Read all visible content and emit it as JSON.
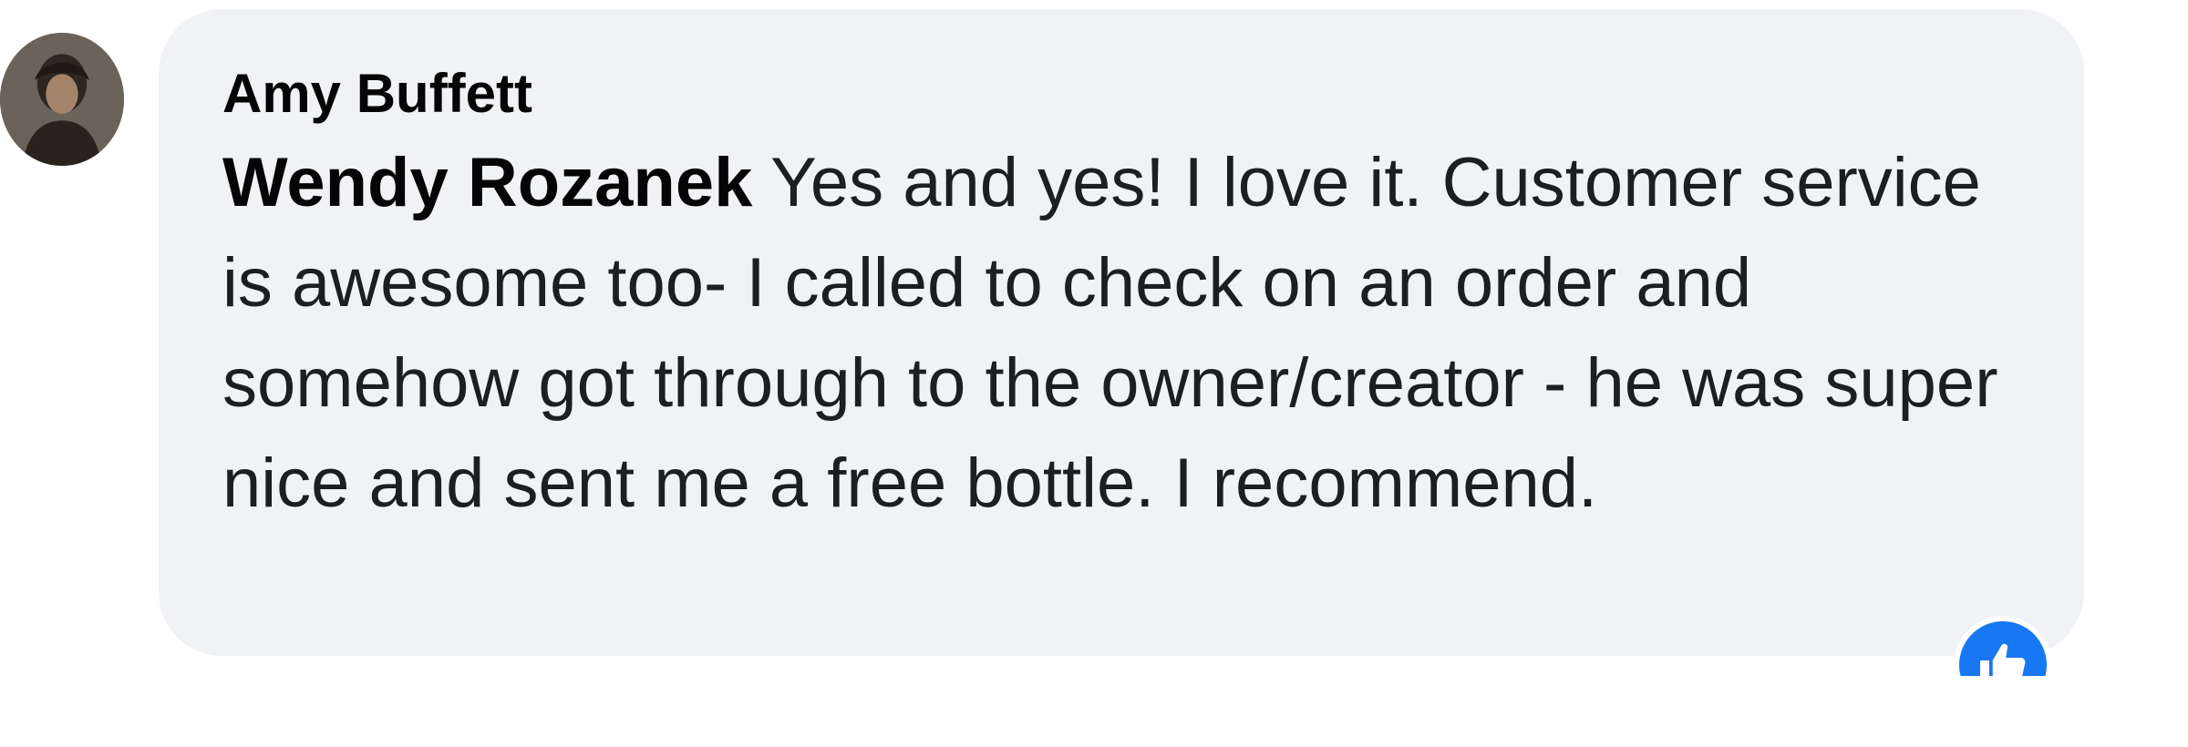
{
  "comment": {
    "author": "Amy Buffett",
    "mention": "Wendy Rozanek",
    "body": " Yes and yes! I love it. Customer service is awesome too- I called to check on an order and somehow got through to the owner/creator - he was super nice and sent me a free bottle. I recommend."
  },
  "reaction": {
    "icon": "like-icon",
    "color": "#1877f2"
  },
  "colors": {
    "bubble_bg": "#f0f2f5",
    "text": "#1c1e21",
    "author": "#050505"
  }
}
